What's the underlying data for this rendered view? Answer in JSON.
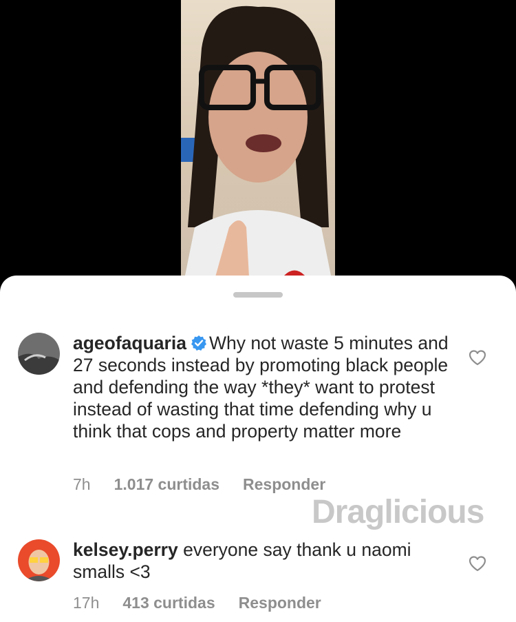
{
  "comments": [
    {
      "username": "ageofaquaria",
      "verified": true,
      "text": "Why not waste 5 minutes and 27 seconds instead by promoting black people and defending the way *they* want to protest instead of wasting that time defending why u think that cops and property matter more",
      "time": "7h",
      "likes": "1.017 curtidas",
      "reply": "Responder"
    },
    {
      "username": "kelsey.perry",
      "verified": false,
      "text": "everyone say thank u naomi smalls <3",
      "time": "17h",
      "likes": "413 curtidas",
      "reply": "Responder"
    }
  ],
  "watermark": "Draglicious",
  "colors": {
    "verified_badge": "#3897f0",
    "meta_text": "#8e8e8e",
    "body_text": "#262626"
  },
  "icons": {
    "like": "heart-outline-icon",
    "verified": "verified-badge-icon"
  }
}
